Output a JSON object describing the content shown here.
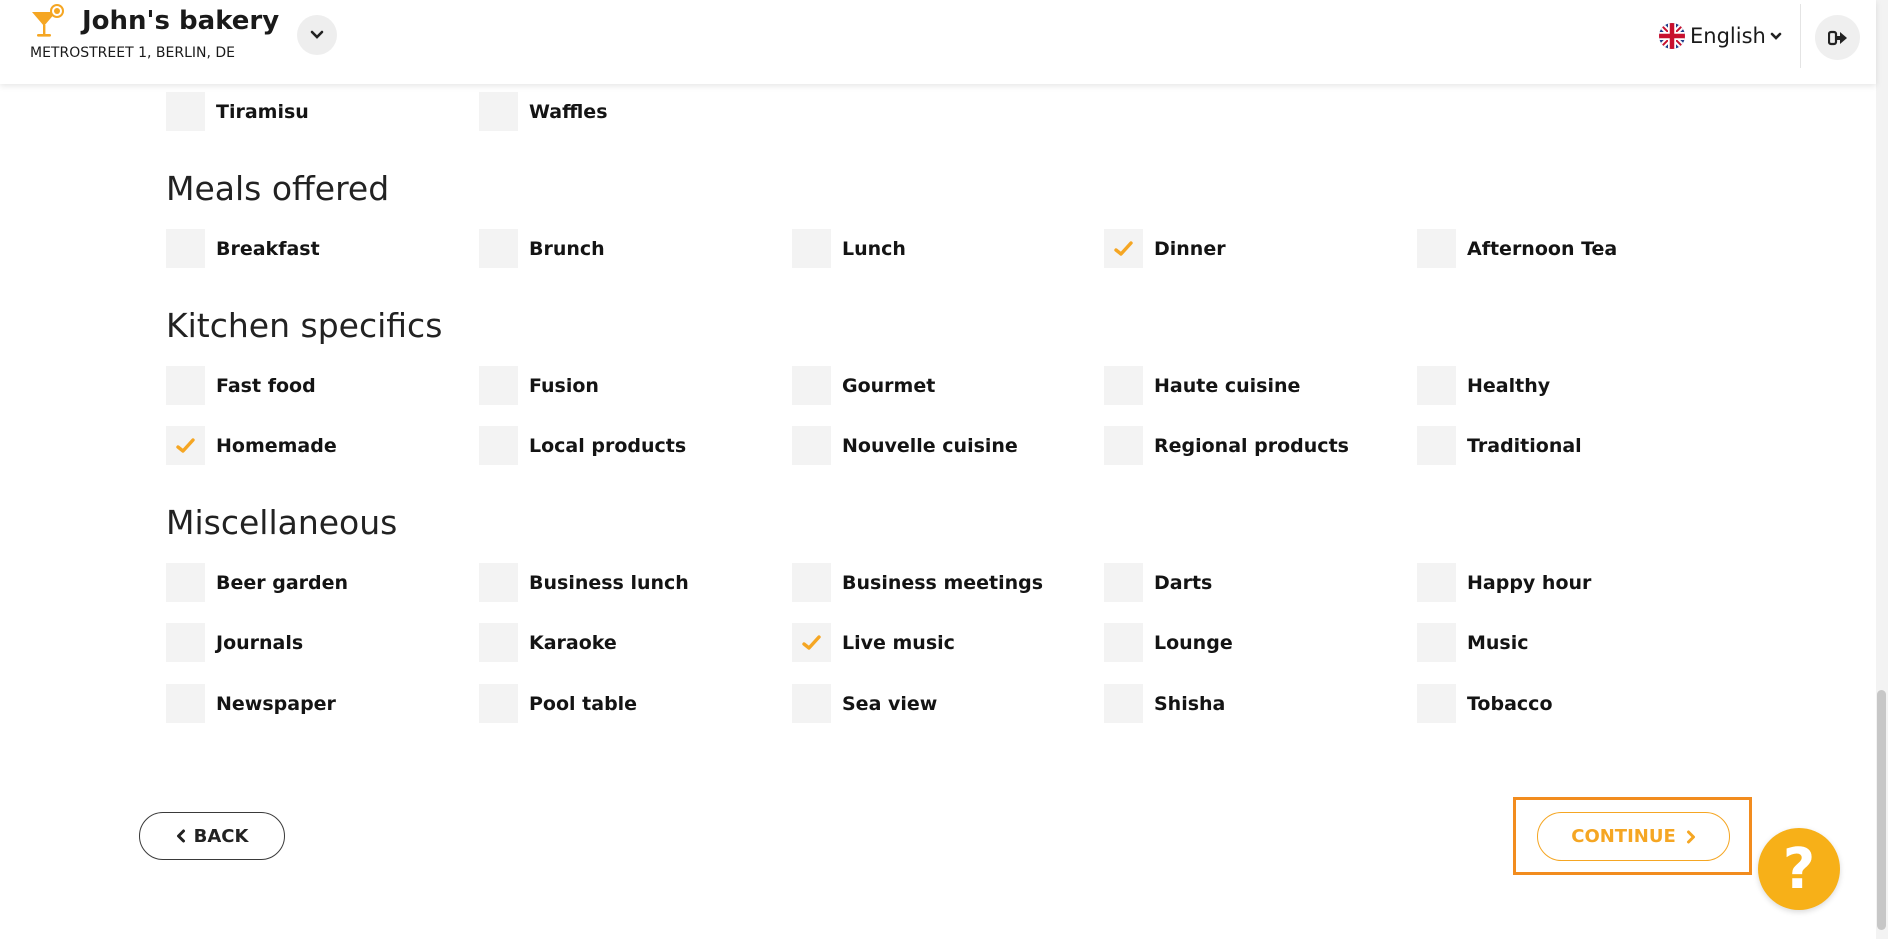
{
  "header": {
    "business_name": "John's bakery",
    "address": "METROSTREET 1, BERLIN, DE",
    "language": "English"
  },
  "top_row": {
    "options": [
      {
        "label": "Tiramisu",
        "checked": false
      },
      {
        "label": "Waffles",
        "checked": false
      }
    ]
  },
  "sections": [
    {
      "title": "Meals offered",
      "options": [
        {
          "label": "Breakfast",
          "checked": false
        },
        {
          "label": "Brunch",
          "checked": false
        },
        {
          "label": "Lunch",
          "checked": false
        },
        {
          "label": "Dinner",
          "checked": true
        },
        {
          "label": "Afternoon Tea",
          "checked": false
        }
      ]
    },
    {
      "title": "Kitchen specifics",
      "options": [
        {
          "label": "Fast food",
          "checked": false
        },
        {
          "label": "Fusion",
          "checked": false
        },
        {
          "label": "Gourmet",
          "checked": false
        },
        {
          "label": "Haute cuisine",
          "checked": false
        },
        {
          "label": "Healthy",
          "checked": false
        },
        {
          "label": "Homemade",
          "checked": true
        },
        {
          "label": "Local products",
          "checked": false
        },
        {
          "label": "Nouvelle cuisine",
          "checked": false
        },
        {
          "label": "Regional products",
          "checked": false
        },
        {
          "label": "Traditional",
          "checked": false
        }
      ]
    },
    {
      "title": "Miscellaneous",
      "options": [
        {
          "label": "Beer garden",
          "checked": false
        },
        {
          "label": "Business lunch",
          "checked": false
        },
        {
          "label": "Business meetings",
          "checked": false
        },
        {
          "label": "Darts",
          "checked": false
        },
        {
          "label": "Happy hour",
          "checked": false
        },
        {
          "label": "Journals",
          "checked": false
        },
        {
          "label": "Karaoke",
          "checked": false
        },
        {
          "label": "Live music",
          "checked": true
        },
        {
          "label": "Lounge",
          "checked": false
        },
        {
          "label": "Music",
          "checked": false
        },
        {
          "label": "Newspaper",
          "checked": false
        },
        {
          "label": "Pool table",
          "checked": false
        },
        {
          "label": "Sea view",
          "checked": false
        },
        {
          "label": "Shisha",
          "checked": false
        },
        {
          "label": "Tobacco",
          "checked": false
        }
      ]
    }
  ],
  "footer": {
    "back_label": "BACK",
    "continue_label": "CONTINUE"
  },
  "colors": {
    "accent": "#f5a623",
    "highlight": "#f28c1e",
    "checkbox_bg": "#f3f3f3"
  },
  "icons": [
    "cocktail-logo-icon",
    "chevron-down-icon",
    "uk-flag-icon",
    "logout-icon",
    "checkmark-icon",
    "chevron-left-icon",
    "chevron-right-icon",
    "question-mark-icon"
  ]
}
